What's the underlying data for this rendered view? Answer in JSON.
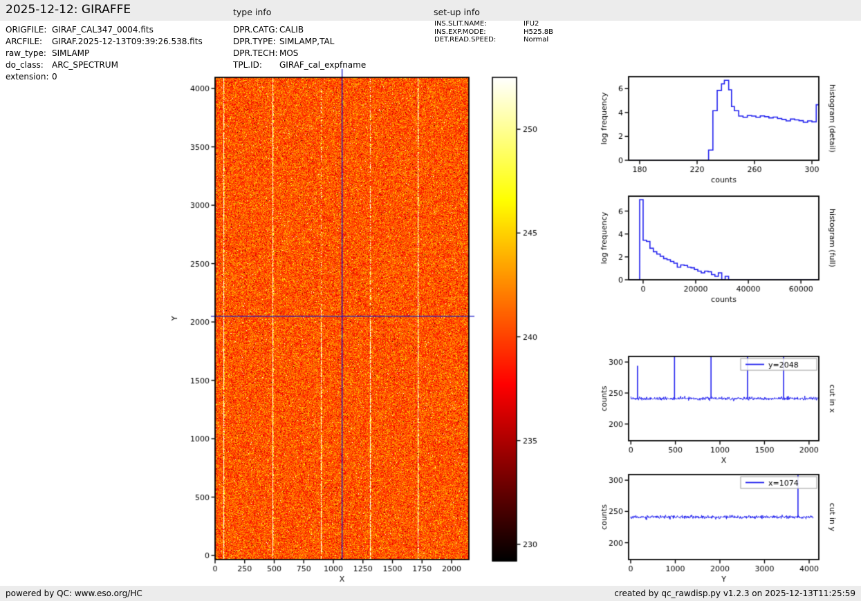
{
  "header": {
    "title": "2025-12-12: GIRAFFE",
    "type_info_heading": "type info",
    "setup_info_heading": "set-up info"
  },
  "meta": {
    "rows": [
      {
        "label": "ORIGFILE:",
        "value": "GIRAF_CAL347_0004.fits"
      },
      {
        "label": "ARCFILE:",
        "value": "GIRAF.2025-12-13T09:39:26.538.fits"
      },
      {
        "label": "raw_type:",
        "value": "SIMLAMP"
      },
      {
        "label": "do_class:",
        "value": "ARC_SPECTRUM"
      },
      {
        "label": "extension:",
        "value": "0"
      }
    ]
  },
  "type_info": {
    "rows": [
      {
        "label": "DPR.CATG:",
        "value": "CALIB"
      },
      {
        "label": "DPR.TYPE:",
        "value": "SIMLAMP,TAL"
      },
      {
        "label": "DPR.TECH:",
        "value": "MOS"
      },
      {
        "label": "TPL.ID:",
        "value": "GIRAF_cal_expfname"
      }
    ]
  },
  "setup_info": {
    "rows": [
      {
        "label": "INS.SLIT.NAME:",
        "value": "IFU2"
      },
      {
        "label": "INS.EXP.MODE:",
        "value": "H525.8B"
      },
      {
        "label": "DET.READ.SPEED:",
        "value": "Normal"
      }
    ]
  },
  "footer": {
    "left": "powered by QC: www.eso.org/HC",
    "right": "created by qc_rawdisp.py v1.2.3 on 2025-12-13T11:25:59"
  },
  "chart_data": [
    {
      "id": "main-image",
      "type": "heatmap",
      "xlabel": "X",
      "ylabel": "Y",
      "xlim": [
        0,
        2146
      ],
      "ylim": [
        -35,
        4095
      ],
      "xticks": [
        0,
        250,
        500,
        750,
        1000,
        1250,
        1500,
        1750,
        2000
      ],
      "yticks": [
        0,
        500,
        1000,
        1500,
        2000,
        2500,
        3000,
        3500,
        4000
      ],
      "colormap": "hot",
      "vmin": 229.2,
      "vmax": 252.5,
      "background_mean": 240.6,
      "background_sigma": 2.1,
      "lamp_line_x": [
        70,
        485,
        895,
        1310,
        1715
      ],
      "lamp_line_solidity_upper": [
        0.85,
        0.9,
        0.35,
        0.5,
        0.85
      ],
      "lamp_line_solidity_lower": [
        0.9,
        0.9,
        0.8,
        0.85,
        0.9
      ],
      "crosshair": {
        "x": 1074,
        "y": 2048,
        "color": "#1a1ac8"
      },
      "seed": 42
    },
    {
      "id": "colorbar",
      "type": "colorbar",
      "colormap": "hot",
      "vmin": 229.2,
      "vmax": 252.5,
      "ticks": [
        230,
        235,
        240,
        245,
        250
      ]
    },
    {
      "id": "hist-detail",
      "type": "step-line",
      "side_label": "histogram (detail)",
      "xlabel": "counts",
      "ylabel": "log frequency",
      "color": "#2222ee",
      "xlim": [
        172.3,
        304.8
      ],
      "ylim": [
        0,
        7
      ],
      "xticks": [
        180,
        220,
        260,
        300
      ],
      "yticks": [
        0,
        2,
        4,
        6
      ],
      "points": [
        [
          172.3,
          0
        ],
        [
          228,
          0
        ],
        [
          228,
          0.85
        ],
        [
          231,
          0.85
        ],
        [
          231,
          4.15
        ],
        [
          234,
          4.15
        ],
        [
          234,
          5.85
        ],
        [
          237,
          5.85
        ],
        [
          237,
          6.4
        ],
        [
          239,
          6.4
        ],
        [
          239,
          6.7
        ],
        [
          242,
          6.7
        ],
        [
          242,
          5.9
        ],
        [
          244,
          5.9
        ],
        [
          244,
          4.5
        ],
        [
          246,
          4.5
        ],
        [
          246,
          4.15
        ],
        [
          249,
          4.15
        ],
        [
          249,
          3.7
        ],
        [
          252,
          3.7
        ],
        [
          252,
          3.6
        ],
        [
          255,
          3.6
        ],
        [
          255,
          3.75
        ],
        [
          258,
          3.75
        ],
        [
          258,
          3.7
        ],
        [
          261,
          3.7
        ],
        [
          261,
          3.6
        ],
        [
          264,
          3.6
        ],
        [
          264,
          3.72
        ],
        [
          267,
          3.72
        ],
        [
          267,
          3.65
        ],
        [
          270,
          3.65
        ],
        [
          270,
          3.55
        ],
        [
          273,
          3.55
        ],
        [
          273,
          3.62
        ],
        [
          276,
          3.62
        ],
        [
          276,
          3.5
        ],
        [
          279,
          3.5
        ],
        [
          279,
          3.42
        ],
        [
          282,
          3.42
        ],
        [
          282,
          3.3
        ],
        [
          285,
          3.3
        ],
        [
          285,
          3.45
        ],
        [
          288,
          3.45
        ],
        [
          288,
          3.38
        ],
        [
          291,
          3.38
        ],
        [
          291,
          3.32
        ],
        [
          294,
          3.32
        ],
        [
          294,
          3.18
        ],
        [
          297,
          3.18
        ],
        [
          297,
          3.3
        ],
        [
          300,
          3.3
        ],
        [
          300,
          3.22
        ],
        [
          303,
          3.22
        ],
        [
          303,
          4.65
        ],
        [
          304.8,
          4.65
        ]
      ]
    },
    {
      "id": "hist-full",
      "type": "step-line",
      "side_label": "histogram (full)",
      "xlabel": "counts",
      "ylabel": "log frequency",
      "color": "#2222ee",
      "xlim": [
        -5500,
        66800
      ],
      "ylim": [
        0,
        7.3
      ],
      "xticks": [
        0,
        20000,
        40000,
        60000
      ],
      "yticks": [
        0,
        2,
        4,
        6
      ],
      "points": [
        [
          -5500,
          0
        ],
        [
          -1300,
          0
        ],
        [
          -1300,
          7.0
        ],
        [
          0,
          7.0
        ],
        [
          0,
          3.45
        ],
        [
          1300,
          3.45
        ],
        [
          1300,
          3.35
        ],
        [
          2600,
          3.35
        ],
        [
          2600,
          2.75
        ],
        [
          3900,
          2.75
        ],
        [
          3900,
          2.45
        ],
        [
          5200,
          2.45
        ],
        [
          5200,
          2.25
        ],
        [
          6500,
          2.25
        ],
        [
          6500,
          2.05
        ],
        [
          7800,
          2.05
        ],
        [
          7800,
          1.85
        ],
        [
          9100,
          1.85
        ],
        [
          9100,
          1.75
        ],
        [
          10400,
          1.75
        ],
        [
          10400,
          1.6
        ],
        [
          11700,
          1.6
        ],
        [
          11700,
          1.45
        ],
        [
          13000,
          1.45
        ],
        [
          13000,
          1.1
        ],
        [
          14300,
          1.1
        ],
        [
          14300,
          1.3
        ],
        [
          15600,
          1.3
        ],
        [
          15600,
          1.25
        ],
        [
          16900,
          1.25
        ],
        [
          16900,
          1.1
        ],
        [
          18200,
          1.1
        ],
        [
          18200,
          1.05
        ],
        [
          19500,
          1.05
        ],
        [
          19500,
          0.9
        ],
        [
          20800,
          0.9
        ],
        [
          20800,
          0.75
        ],
        [
          22100,
          0.75
        ],
        [
          22100,
          0.6
        ],
        [
          23400,
          0.6
        ],
        [
          23400,
          0.75
        ],
        [
          24700,
          0.75
        ],
        [
          24700,
          0.7
        ],
        [
          26000,
          0.7
        ],
        [
          26000,
          0.45
        ],
        [
          27300,
          0.45
        ],
        [
          27300,
          0.3
        ],
        [
          28600,
          0.3
        ],
        [
          28600,
          0.6
        ],
        [
          29900,
          0.6
        ],
        [
          29900,
          0.0
        ],
        [
          31200,
          0.0
        ],
        [
          31200,
          0.3
        ],
        [
          32500,
          0.3
        ],
        [
          32500,
          0
        ],
        [
          66800,
          0
        ]
      ]
    },
    {
      "id": "cut-x",
      "type": "noise-line",
      "side_label": "cut in x",
      "xlabel": "X",
      "ylabel": "counts",
      "legend": "y=2048",
      "color": "#2222ee",
      "xlim": [
        -25,
        2110
      ],
      "ylim": [
        173,
        309
      ],
      "xticks": [
        0,
        500,
        1000,
        1500,
        2000
      ],
      "yticks": [
        200,
        250,
        300
      ],
      "baseline": 241,
      "noise_sigma": 1.2,
      "data_range": [
        0,
        2148
      ],
      "spikes": [
        {
          "x": 75,
          "top": 294
        },
        {
          "x": 490,
          "top": 330
        },
        {
          "x": 900,
          "top": 330
        },
        {
          "x": 1310,
          "top": 330
        },
        {
          "x": 1715,
          "top": 330
        }
      ],
      "seed": 7
    },
    {
      "id": "cut-y",
      "type": "noise-line",
      "side_label": "cut in y",
      "xlabel": "Y",
      "ylabel": "counts",
      "legend": "x=1074",
      "color": "#2222ee",
      "xlim": [
        -46,
        4217
      ],
      "ylim": [
        173,
        309
      ],
      "xticks": [
        0,
        1000,
        2000,
        3000,
        4000
      ],
      "yticks": [
        200,
        250,
        300
      ],
      "baseline": 241,
      "noise_sigma": 1.2,
      "data_range": [
        0,
        4096
      ],
      "spikes": [
        {
          "x": 3750,
          "top": 330
        }
      ],
      "seed": 11
    }
  ]
}
